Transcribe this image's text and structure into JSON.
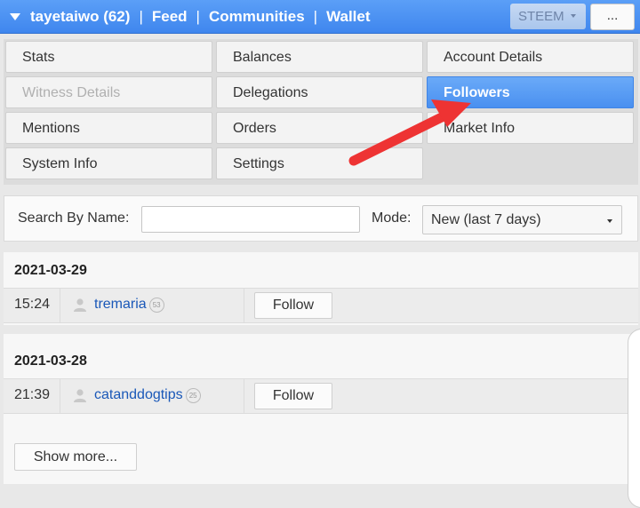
{
  "header": {
    "user": "tayetaiwo (62)",
    "links": [
      "Feed",
      "Communities",
      "Wallet"
    ],
    "separator": "|",
    "token_select": "STEEM",
    "more_label": "..."
  },
  "menu": {
    "items": [
      {
        "label": "Stats"
      },
      {
        "label": "Balances"
      },
      {
        "label": "Account Details"
      },
      {
        "label": "Witness Details"
      },
      {
        "label": "Delegations"
      },
      {
        "label": "Followers"
      },
      {
        "label": "Mentions"
      },
      {
        "label": "Orders"
      },
      {
        "label": "Market Info"
      },
      {
        "label": "System Info"
      },
      {
        "label": "Settings"
      }
    ],
    "active": "Followers",
    "disabled": "Witness Details"
  },
  "search": {
    "label": "Search By Name:",
    "value": "",
    "mode_label": "Mode:",
    "mode_value": "New (last 7 days)"
  },
  "results": {
    "groups": [
      {
        "date": "2021-03-29",
        "time": "15:24",
        "user": "tremaria",
        "rep": "53",
        "action": "Follow"
      },
      {
        "date": "2021-03-28",
        "time": "21:39",
        "user": "catanddogtips",
        "rep": "25",
        "action": "Follow"
      }
    ],
    "show_more": "Show more..."
  },
  "colors": {
    "accent": "#4a90f0",
    "arrow": "#ee3333",
    "link": "#1a58b8"
  }
}
